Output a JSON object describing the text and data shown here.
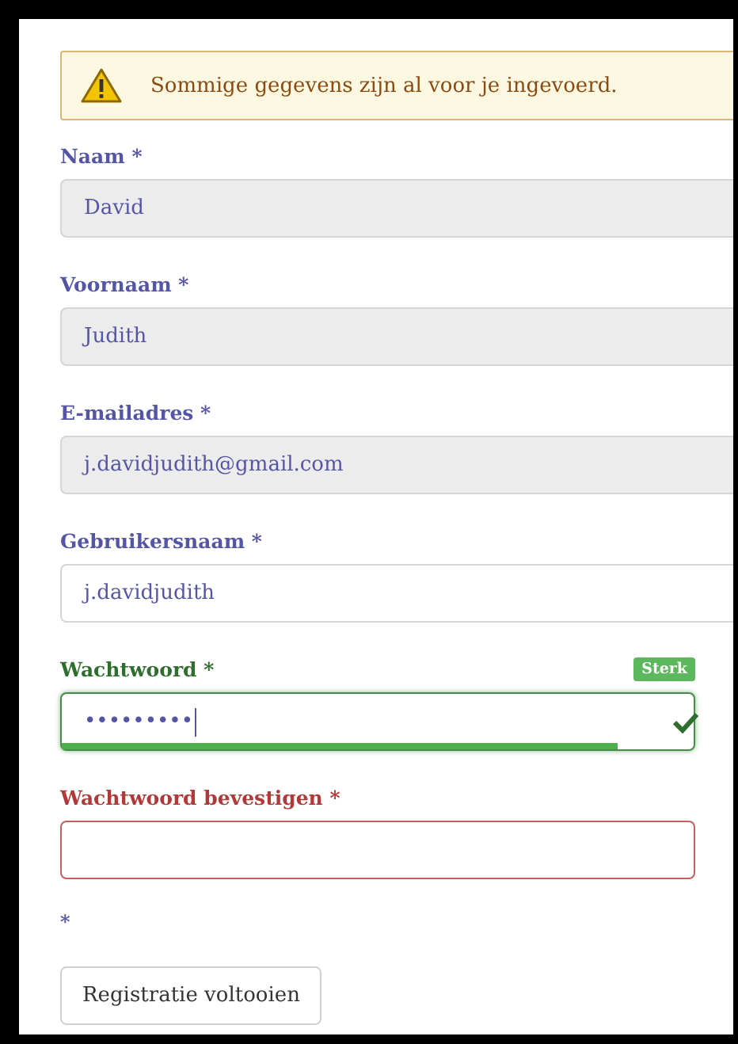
{
  "alert": {
    "text": "Sommige gegevens zijn al voor je ingevoerd."
  },
  "fields": [
    {
      "label": "Naam *",
      "value": "David",
      "kind": "prefilled"
    },
    {
      "label": "Voornaam *",
      "value": "Judith",
      "kind": "prefilled"
    },
    {
      "label": "E-mailadres *",
      "value": "j.davidjudith@gmail.com",
      "kind": "prefilled"
    },
    {
      "label": "Gebruikersnaam *",
      "value": "j.davidjudith",
      "kind": "normal"
    },
    {
      "label": "Wachtwoord *",
      "value": "•••••••••",
      "kind": "valid",
      "focused": true,
      "strength": {
        "label": "Sterk",
        "level": 0.88
      }
    },
    {
      "label": "Wachtwoord bevestigen *",
      "kind": "invalid"
    }
  ],
  "required_note": "*",
  "submit_button": "Registratie voltooien"
}
